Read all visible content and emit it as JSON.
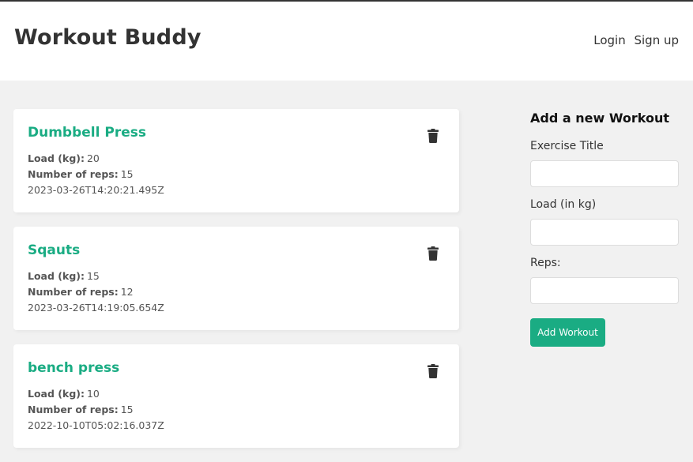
{
  "header": {
    "brand": "Workout Buddy",
    "nav": {
      "login": "Login",
      "signup": "Sign up"
    }
  },
  "labels": {
    "load": "Load (kg):",
    "reps": "Number of reps:"
  },
  "workouts": [
    {
      "title": "Dumbbell Press",
      "load": "20",
      "reps": "15",
      "created": "2023-03-26T14:20:21.495Z"
    },
    {
      "title": "Sqauts",
      "load": "15",
      "reps": "12",
      "created": "2023-03-26T14:19:05.654Z"
    },
    {
      "title": "bench press",
      "load": "10",
      "reps": "15",
      "created": "2022-10-10T05:02:16.037Z"
    }
  ],
  "form": {
    "title": "Add a new Workout",
    "exercise_label": "Exercise Title",
    "load_label": "Load (in kg)",
    "reps_label": "Reps:",
    "exercise_value": "",
    "load_value": "",
    "reps_value": "",
    "submit_label": "Add Workout"
  },
  "icons": {
    "delete": "trash-icon"
  },
  "colors": {
    "accent": "#1aac83",
    "background": "#f1f1f1"
  }
}
